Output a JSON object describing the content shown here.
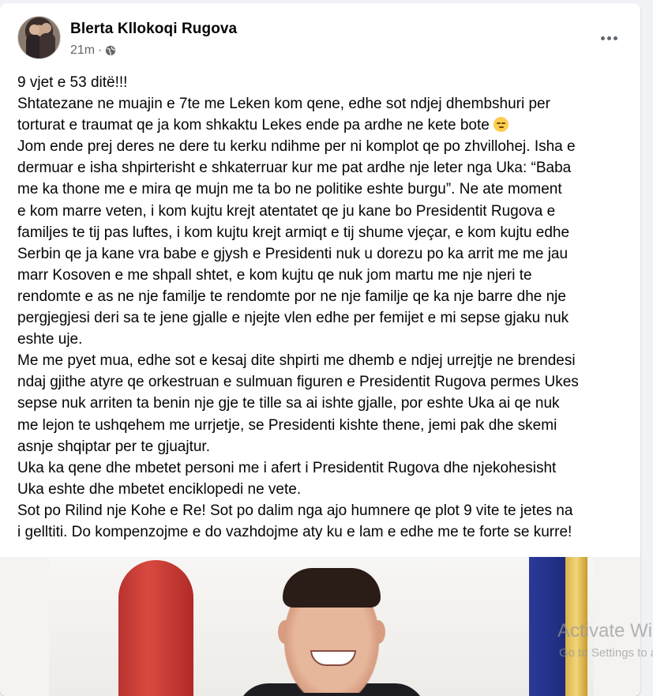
{
  "post": {
    "author": "Blerta Kllokoqi Rugova",
    "time": "21m",
    "separator": "·",
    "privacy_icon": "globe-icon",
    "menu_icon": "more-options-icon",
    "lines": [
      "9 vjet e 53 ditë!!!",
      "Shtatezane ne muajin e 7te me Leken kom qene, edhe sot ndjej dhembshuri per",
      "torturat e traumat qe ja kom shkaktu Lekes ende pa ardhe ne kete bote",
      "Jom ende prej deres ne dere tu kerku ndihme per ni komplot qe po zhvillohej. Isha e",
      "dermuar e isha shpirterisht e shkaterruar kur me pat ardhe nje leter nga Uka: “Baba",
      "me ka thone me e mira qe mujn me ta bo ne politike eshte burgu”. Ne ate moment",
      "e kom marre veten, i kom kujtu krejt atentatet qe ju kane bo Presidentit Rugova e",
      "familjes te tij pas luftes, i kom kujtu krejt armiqt e tij shume vjeçar, e kom kujtu edhe",
      "Serbin qe ja kane vra babe e gjysh e Presidenti nuk u dorezu po ka arrit me me jau",
      "marr Kosoven e me shpall shtet, e kom kujtu qe nuk jom martu me nje njeri te",
      "rendomte e as ne nje familje te rendomte por ne nje familje qe ka nje barre dhe nje",
      "pergjegjesi deri sa te jene gjalle e njejte vlen edhe per femijet e mi sepse gjaku nuk",
      "eshte uje.",
      "Me me pyet mua, edhe sot e kesaj dite shpirti me dhemb e ndjej urrejtje ne brendesi",
      "ndaj gjithe atyre qe orkestruan e sulmuan figuren e Presidentit Rugova permes Ukes",
      "sepse nuk arriten ta benin nje gje te tille sa ai ishte gjalle, por eshte Uka ai qe nuk",
      "me lejon te ushqehem me urrjetje, se Presidenti kishte thene, jemi pak dhe skemi",
      "asnje shqiptar per te gjuajtur.",
      "Uka ka qene dhe mbetet personi me i afert i Presidentit Rugova dhe njekohesisht",
      "Uka eshte dhe mbetet enciklopedi ne vete.",
      "Sot po Rilind nje Kohe e Re! Sot po dalim nga ajo humnere qe plot 9 vite te jetes na",
      "i gelltiti. Do kompenzojme e do vazhdojme aty ku e lam e edhe me te forte se kurre!"
    ],
    "emoji": "relieved-face-emoji"
  },
  "os_watermark": {
    "title": "Activate Windows",
    "subtitle": "Go to Settings to activate Windows."
  }
}
